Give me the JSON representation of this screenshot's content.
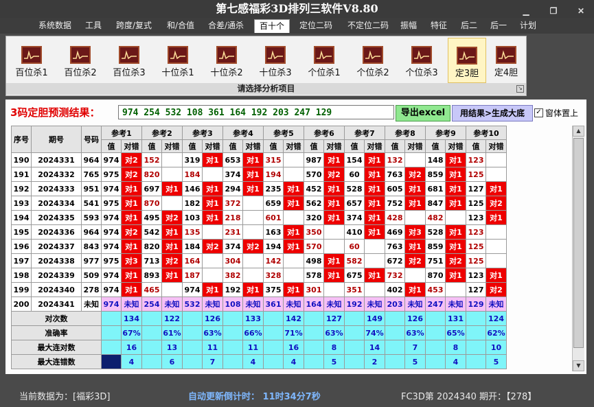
{
  "window": {
    "title": "第七感福彩3D排列三软件V8.80",
    "min": "▁",
    "restore": "❐",
    "close": "✕"
  },
  "menu": [
    "系统数据",
    "工具",
    "跨度/复式",
    "和/合值",
    "合差/通杀",
    "百十个",
    "定位二码",
    "不定位二码",
    "振幅",
    "特征",
    "后二",
    "后一",
    "计划"
  ],
  "menu_active": 5,
  "ribbon": {
    "buttons": [
      "百位杀1",
      "百位杀2",
      "百位杀3",
      "十位杀1",
      "十位杀2",
      "十位杀3",
      "个位杀1",
      "个位杀2",
      "个位杀3",
      "定3胆",
      "定4胆"
    ],
    "selected": 9,
    "caption": "请选择分析项目"
  },
  "prediction": {
    "label": "3码定胆预测结果：",
    "value": "974 254 532 108 361 164 192 203 247 129",
    "export_button": "导出excel",
    "generate_button": "用结果>生成大底",
    "topmost_label": "窗体置上",
    "topmost_checked": true
  },
  "table": {
    "headers": {
      "seq": "序号",
      "period": "期号",
      "number": "号码",
      "groups": [
        "参考1",
        "参考2",
        "参考3",
        "参考4",
        "参考5",
        "参考6",
        "参考7",
        "参考8",
        "参考9",
        "参考10"
      ],
      "value": "值",
      "result": "对错"
    },
    "rows": [
      {
        "seq": "190",
        "period": "2024331",
        "num": "964",
        "cells": [
          [
            "974",
            "对2"
          ],
          [
            "152",
            ""
          ],
          [
            "319",
            "对1"
          ],
          [
            "653",
            "对1"
          ],
          [
            "315",
            ""
          ],
          [
            "987",
            "对1"
          ],
          [
            "154",
            "对1"
          ],
          [
            "132",
            ""
          ],
          [
            "148",
            "对1"
          ],
          [
            "123",
            ""
          ]
        ]
      },
      {
        "seq": "191",
        "period": "2024332",
        "num": "765",
        "cells": [
          [
            "975",
            "对2"
          ],
          [
            "820",
            ""
          ],
          [
            "184",
            ""
          ],
          [
            "374",
            "对1"
          ],
          [
            "194",
            ""
          ],
          [
            "570",
            "对2"
          ],
          [
            "60",
            "对1"
          ],
          [
            "763",
            "对2"
          ],
          [
            "859",
            "对1"
          ],
          [
            "125",
            ""
          ]
        ]
      },
      {
        "seq": "192",
        "period": "2024333",
        "num": "951",
        "cells": [
          [
            "974",
            "对1"
          ],
          [
            "697",
            "对1"
          ],
          [
            "146",
            "对1"
          ],
          [
            "294",
            "对1"
          ],
          [
            "235",
            "对1"
          ],
          [
            "452",
            "对1"
          ],
          [
            "528",
            "对1"
          ],
          [
            "605",
            "对1"
          ],
          [
            "681",
            "对1"
          ],
          [
            "127",
            "对1"
          ]
        ]
      },
      {
        "seq": "193",
        "period": "2024334",
        "num": "541",
        "cells": [
          [
            "975",
            "对1"
          ],
          [
            "870",
            ""
          ],
          [
            "182",
            "对1"
          ],
          [
            "372",
            ""
          ],
          [
            "659",
            "对1"
          ],
          [
            "562",
            "对1"
          ],
          [
            "657",
            "对1"
          ],
          [
            "752",
            "对1"
          ],
          [
            "847",
            "对1"
          ],
          [
            "125",
            "对2"
          ]
        ]
      },
      {
        "seq": "194",
        "period": "2024335",
        "num": "593",
        "cells": [
          [
            "974",
            "对1"
          ],
          [
            "495",
            "对2"
          ],
          [
            "103",
            "对1"
          ],
          [
            "218",
            ""
          ],
          [
            "601",
            ""
          ],
          [
            "320",
            "对1"
          ],
          [
            "374",
            "对1"
          ],
          [
            "428",
            ""
          ],
          [
            "482",
            ""
          ],
          [
            "123",
            "对1"
          ]
        ]
      },
      {
        "seq": "195",
        "period": "2024336",
        "num": "964",
        "cells": [
          [
            "974",
            "对2"
          ],
          [
            "542",
            "对1"
          ],
          [
            "135",
            ""
          ],
          [
            "231",
            ""
          ],
          [
            "163",
            "对1"
          ],
          [
            "350",
            ""
          ],
          [
            "410",
            "对1"
          ],
          [
            "469",
            "对3"
          ],
          [
            "528",
            "对1"
          ],
          [
            "123",
            ""
          ]
        ]
      },
      {
        "seq": "196",
        "period": "2024337",
        "num": "843",
        "cells": [
          [
            "974",
            "对1"
          ],
          [
            "820",
            "对1"
          ],
          [
            "184",
            "对2"
          ],
          [
            "374",
            "对2"
          ],
          [
            "194",
            "对1"
          ],
          [
            "570",
            ""
          ],
          [
            "60",
            ""
          ],
          [
            "763",
            "对1"
          ],
          [
            "859",
            "对1"
          ],
          [
            "125",
            ""
          ]
        ]
      },
      {
        "seq": "197",
        "period": "2024338",
        "num": "977",
        "cells": [
          [
            "975",
            "对3"
          ],
          [
            "713",
            "对2"
          ],
          [
            "164",
            ""
          ],
          [
            "304",
            ""
          ],
          [
            "142",
            ""
          ],
          [
            "498",
            "对1"
          ],
          [
            "582",
            ""
          ],
          [
            "672",
            "对2"
          ],
          [
            "751",
            "对2"
          ],
          [
            "125",
            ""
          ]
        ]
      },
      {
        "seq": "198",
        "period": "2024339",
        "num": "509",
        "cells": [
          [
            "974",
            "对1"
          ],
          [
            "893",
            "对1"
          ],
          [
            "187",
            ""
          ],
          [
            "382",
            ""
          ],
          [
            "328",
            ""
          ],
          [
            "578",
            "对1"
          ],
          [
            "675",
            "对1"
          ],
          [
            "732",
            ""
          ],
          [
            "870",
            "对1"
          ],
          [
            "123",
            "对1"
          ]
        ]
      },
      {
        "seq": "199",
        "period": "2024340",
        "num": "278",
        "cells": [
          [
            "974",
            "对1"
          ],
          [
            "465",
            ""
          ],
          [
            "974",
            "对1"
          ],
          [
            "192",
            "对1"
          ],
          [
            "375",
            "对1"
          ],
          [
            "301",
            ""
          ],
          [
            "351",
            ""
          ],
          [
            "402",
            "对1"
          ],
          [
            "453",
            ""
          ],
          [
            "127",
            "对2"
          ]
        ]
      }
    ],
    "predict_row": {
      "seq": "200",
      "period": "2024341",
      "num": "未知",
      "cells": [
        [
          "974",
          "未知"
        ],
        [
          "254",
          "未知"
        ],
        [
          "532",
          "未知"
        ],
        [
          "108",
          "未知"
        ],
        [
          "361",
          "未知"
        ],
        [
          "164",
          "未知"
        ],
        [
          "192",
          "未知"
        ],
        [
          "203",
          "未知"
        ],
        [
          "247",
          "未知"
        ],
        [
          "129",
          "未知"
        ]
      ]
    },
    "stats": [
      {
        "label": "对次数",
        "values": [
          "134",
          "122",
          "126",
          "133",
          "142",
          "127",
          "149",
          "126",
          "131",
          "124"
        ]
      },
      {
        "label": "准确率",
        "values": [
          "67%",
          "61%",
          "63%",
          "66%",
          "71%",
          "63%",
          "74%",
          "63%",
          "65%",
          "62%"
        ]
      },
      {
        "label": "最大连对数",
        "values": [
          "16",
          "13",
          "11",
          "11",
          "16",
          "8",
          "14",
          "7",
          "8",
          "10"
        ]
      },
      {
        "label": "最大连错数",
        "values": [
          "4",
          "6",
          "7",
          "4",
          "4",
          "5",
          "2",
          "5",
          "4",
          "5"
        ]
      }
    ]
  },
  "scroll": {
    "up": "▲",
    "down": "▼"
  },
  "status": {
    "current_label": "当前数据为：[福彩3D]",
    "countdown": "自动更新倒计时：  11时34分7秒",
    "period_info": "FC3D第 2024340 期开：【278】"
  }
}
